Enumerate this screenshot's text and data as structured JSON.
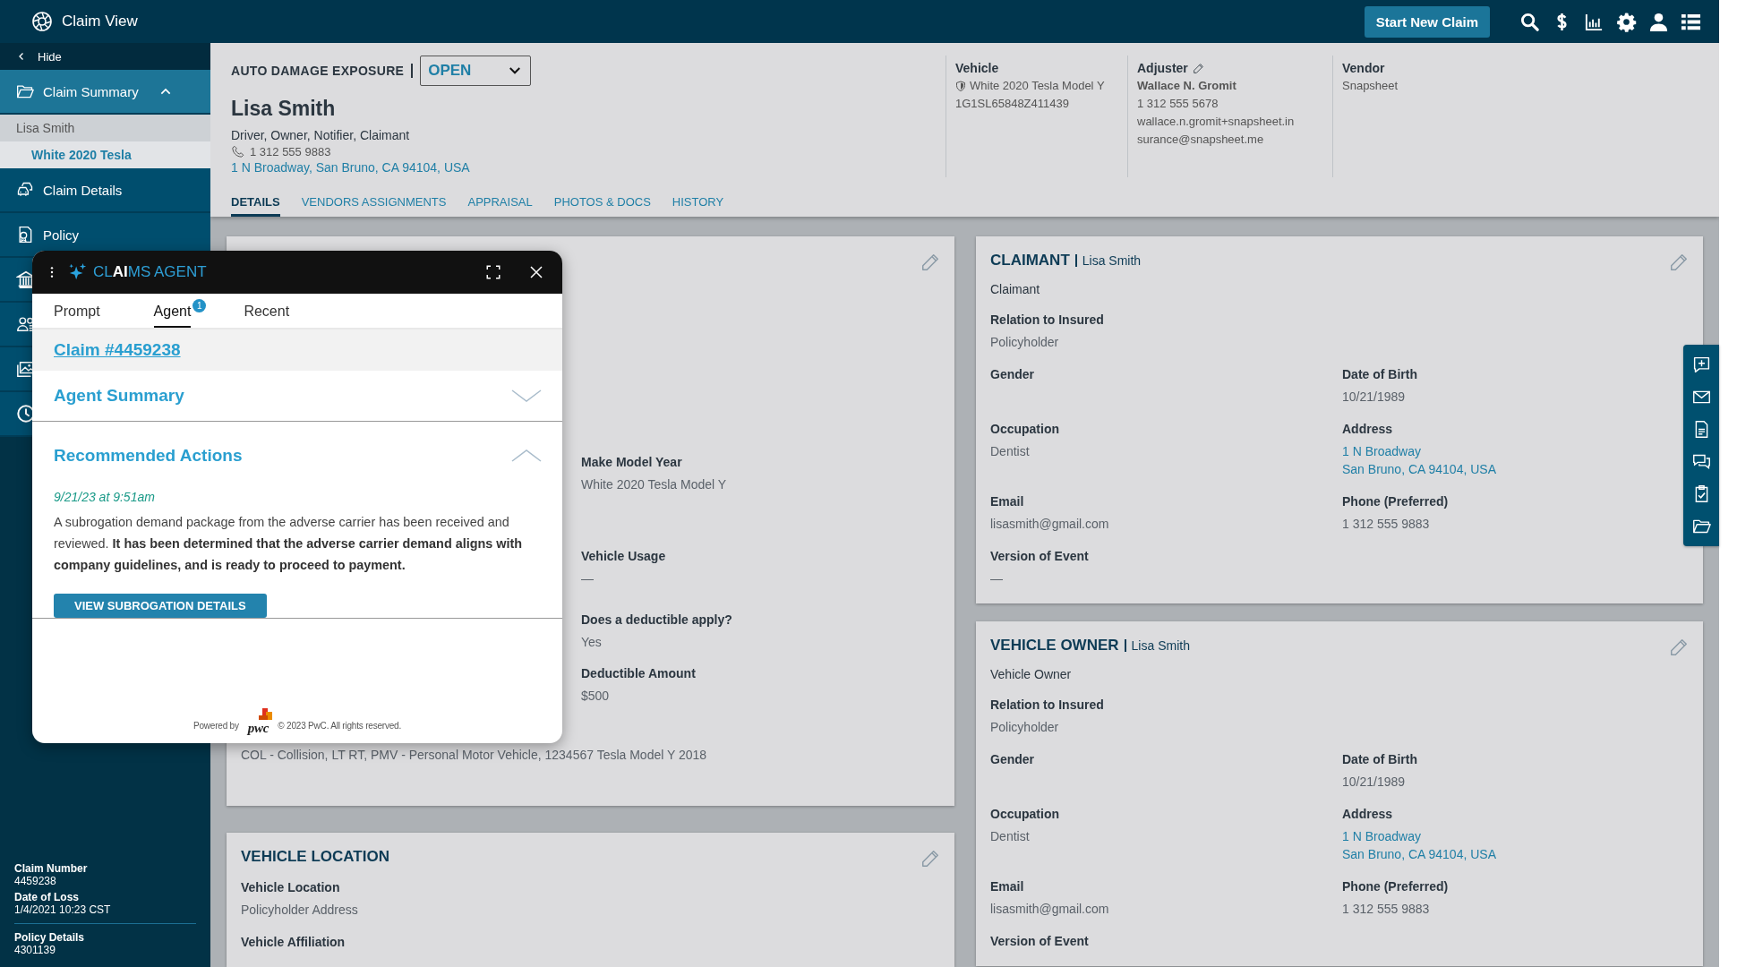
{
  "app": {
    "title": "Claim View",
    "primary_button": "Start New Claim"
  },
  "sidebar": {
    "hide_label": "Hide",
    "items": [
      {
        "label": "Claim Summary",
        "selected": true,
        "expanded": true,
        "children": [
          {
            "label": "Lisa Smith",
            "selected": false
          },
          {
            "label": "White 2020 Tesla",
            "selected": true
          }
        ]
      },
      {
        "label": "Claim Details",
        "selected": false
      },
      {
        "label": "Policy",
        "selected": false
      }
    ],
    "claim_info": [
      [
        {
          "label": "Claim Number",
          "value": "4459238"
        },
        {
          "label": "Date of Loss",
          "value": "1/4/2021 10:23 CST"
        }
      ],
      [
        {
          "label": "Policy Details",
          "value": "4301139"
        }
      ]
    ]
  },
  "header": {
    "exposure_label": "AUTO DAMAGE EXPOSURE",
    "status": "OPEN",
    "name": "Lisa Smith",
    "roles": "Driver, Owner, Notifier, Claimant",
    "phone": "1 312 555 9883",
    "address": "1 N Broadway, San Bruno, CA 94104, USA",
    "info_columns": [
      {
        "title": "Vehicle",
        "editable": false,
        "lines": [
          {
            "kind": "vehicle",
            "text": "White 2020 Tesla Model Y"
          },
          {
            "kind": "text",
            "text": "1G1SL65848Z411439"
          }
        ]
      },
      {
        "title": "Adjuster",
        "editable": true,
        "lines": [
          {
            "kind": "name",
            "text": "Wallace N. Gromit"
          },
          {
            "kind": "text",
            "text": "1 312 555 5678"
          },
          {
            "kind": "email",
            "text": "wallace.n.gromit+snapsheet.insurance@snapsheet.me"
          }
        ]
      },
      {
        "title": "Vendor",
        "editable": false,
        "lines": [
          {
            "kind": "text",
            "text": "Snapsheet"
          }
        ]
      }
    ],
    "tabs": [
      {
        "label": "DETAILS",
        "selected": true
      },
      {
        "label": "VENDORS ASSIGNMENTS",
        "selected": false
      },
      {
        "label": "APPRAISAL",
        "selected": false
      },
      {
        "label": "PHOTOS & DOCS",
        "selected": false
      },
      {
        "label": "HISTORY",
        "selected": false
      }
    ]
  },
  "vehicle_card": {
    "fields": [
      {
        "kind": "text",
        "label": "Make Model Year",
        "lines": [
          "White 2020 Tesla Model Y"
        ]
      },
      {
        "kind": "text",
        "label": "Vehicle Usage",
        "lines": [
          "—"
        ]
      },
      {
        "kind": "text",
        "label": "Does a deductible apply?",
        "lines": [
          "Yes"
        ]
      },
      {
        "kind": "text",
        "label": "Deductible Amount",
        "lines": [
          "$500"
        ]
      }
    ],
    "note": "COL - Collision, LT RT, PMV - Personal Motor Vehicle, 1234567 Tesla Model Y 2018"
  },
  "claimant_card": {
    "title": "CLAIMANT",
    "subtitle": "Lisa Smith",
    "role": "Claimant",
    "rows": [
      [
        {
          "kind": "text",
          "label": "Relation to Insured",
          "lines": [
            "Policyholder"
          ]
        }
      ],
      [
        {
          "kind": "empty",
          "label": "Gender"
        },
        {
          "kind": "text",
          "label": "Date of Birth",
          "lines": [
            "10/21/1989"
          ]
        }
      ],
      [
        {
          "kind": "text",
          "label": "Occupation",
          "lines": [
            "Dentist"
          ]
        },
        {
          "kind": "link",
          "label": "Address",
          "lines": [
            "1 N Broadway",
            "San Bruno, CA 94104, USA"
          ]
        }
      ],
      [
        {
          "kind": "text",
          "label": "Email",
          "lines": [
            "lisasmith@gmail.com"
          ]
        },
        {
          "kind": "text",
          "label": "Phone (Preferred)",
          "lines": [
            "1 312 555 9883"
          ]
        }
      ],
      [
        {
          "kind": "text",
          "label": "Version of Event",
          "lines": [
            "—"
          ]
        }
      ]
    ]
  },
  "owner_card": {
    "title": "VEHICLE OWNER",
    "subtitle": "Lisa Smith",
    "role": "Vehicle Owner",
    "rows": [
      [
        {
          "kind": "text",
          "label": "Relation to Insured",
          "lines": [
            "Policyholder"
          ]
        }
      ],
      [
        {
          "kind": "empty",
          "label": "Gender"
        },
        {
          "kind": "text",
          "label": "Date of Birth",
          "lines": [
            "10/21/1989"
          ]
        }
      ],
      [
        {
          "kind": "text",
          "label": "Occupation",
          "lines": [
            "Dentist"
          ]
        },
        {
          "kind": "link",
          "label": "Address",
          "lines": [
            "1 N Broadway",
            "San Bruno, CA 94104, USA"
          ]
        }
      ],
      [
        {
          "kind": "text",
          "label": "Email",
          "lines": [
            "lisasmith@gmail.com"
          ]
        },
        {
          "kind": "text",
          "label": "Phone (Preferred)",
          "lines": [
            "1 312 555 9883"
          ]
        }
      ],
      [
        {
          "kind": "empty",
          "label": "Version of Event"
        }
      ]
    ]
  },
  "location_card": {
    "title": "VEHICLE LOCATION",
    "rows": [
      [
        {
          "kind": "text",
          "label": "Vehicle Location",
          "lines": [
            "Policyholder Address"
          ]
        }
      ],
      [
        {
          "kind": "empty",
          "label": "Vehicle Affiliation"
        }
      ]
    ]
  },
  "agent": {
    "title": "CL**AI**MS AGENT",
    "tabs": [
      {
        "label": "Prompt",
        "selected": false
      },
      {
        "label": "Agent",
        "selected": true,
        "badge": "1"
      },
      {
        "label": "Recent",
        "selected": false
      }
    ],
    "claim_link": "Claim #4459238",
    "sections": [
      {
        "title": "Agent Summary",
        "expanded": false
      },
      {
        "title": "Recommended Actions",
        "expanded": true,
        "timestamp": "9/21/23 at 9:51am",
        "message": "A subrogation demand package from the adverse carrier has been received and reviewed. **It has been determined that the adverse carrier demand aligns with company guidelines, and is ready to proceed to payment.**",
        "action": "VIEW SUBROGATION DETAILS"
      }
    ],
    "footer": {
      "powered_by": "Powered by",
      "brand": "pwc",
      "copyright": "© 2023 PwC. All rights reserved."
    }
  }
}
